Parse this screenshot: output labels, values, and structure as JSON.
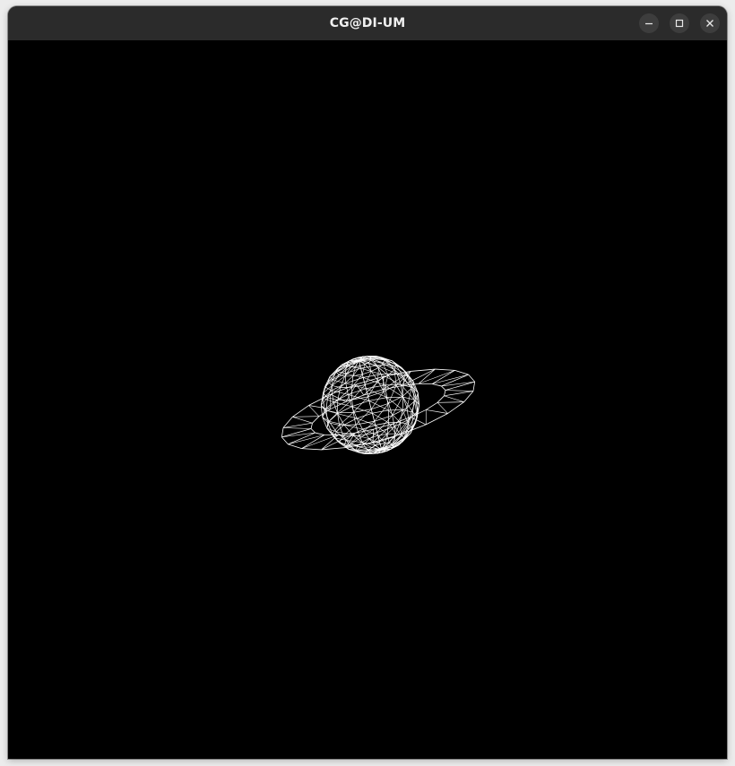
{
  "window": {
    "title": "CG@DI-UM"
  },
  "titlebar_buttons": [
    {
      "name": "minimize",
      "icon": "minimize-icon"
    },
    {
      "name": "maximize",
      "icon": "maximize-icon"
    },
    {
      "name": "close",
      "icon": "close-icon"
    }
  ],
  "scene": {
    "background_color": "#000000",
    "wireframe_color": "#ffffff",
    "objects": [
      "sphere-wireframe",
      "ring-wireframe"
    ]
  }
}
